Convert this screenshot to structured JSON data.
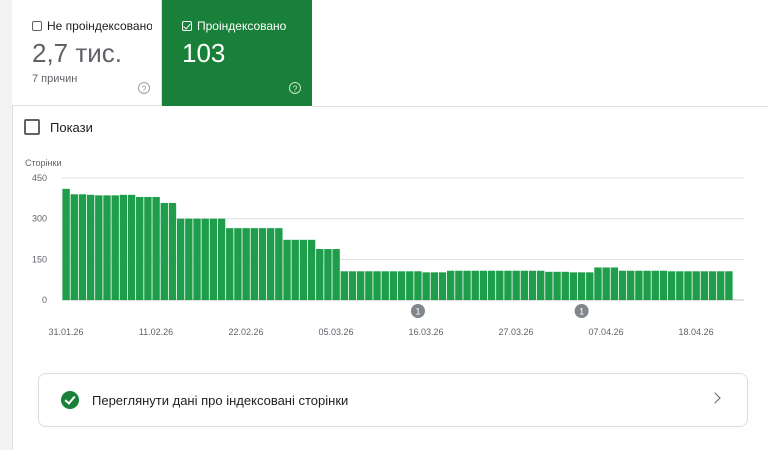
{
  "tiles": {
    "not_indexed": {
      "label": "Не проіндексовано",
      "value": "2,7 тис.",
      "sub": "7 причин",
      "checked": false
    },
    "indexed": {
      "label": "Проіндексовано",
      "value": "103",
      "checked": true
    }
  },
  "show_label": "Покази",
  "chart_data": {
    "type": "bar",
    "ylabel": "Сторінки",
    "yticks": [
      0,
      150,
      300,
      450
    ],
    "ylim": [
      0,
      450
    ],
    "grid": true,
    "xtick_labels": [
      "31.01.26",
      "11.02.26",
      "22.02.26",
      "05.03.26",
      "16.03.26",
      "27.03.26",
      "07.04.26",
      "18.04.26"
    ],
    "xtick_indices": [
      0,
      11,
      22,
      33,
      44,
      55,
      66,
      77
    ],
    "annotations": [
      {
        "index": 43,
        "label": "1"
      },
      {
        "index": 63,
        "label": "1"
      }
    ],
    "color": "#1e9e4a",
    "values": [
      410,
      390,
      390,
      388,
      386,
      386,
      386,
      388,
      388,
      380,
      380,
      380,
      358,
      358,
      300,
      300,
      300,
      300,
      300,
      300,
      265,
      265,
      265,
      265,
      265,
      265,
      265,
      222,
      222,
      222,
      222,
      188,
      188,
      188,
      106,
      106,
      106,
      106,
      106,
      106,
      106,
      106,
      106,
      106,
      102,
      102,
      102,
      108,
      108,
      108,
      108,
      108,
      108,
      108,
      108,
      108,
      108,
      108,
      108,
      104,
      104,
      104,
      102,
      102,
      102,
      120,
      120,
      120,
      108,
      108,
      108,
      108,
      108,
      108,
      106,
      106,
      106,
      106,
      106,
      106,
      106,
      106
    ]
  },
  "link_text": "Переглянути дані про індексовані сторінки"
}
